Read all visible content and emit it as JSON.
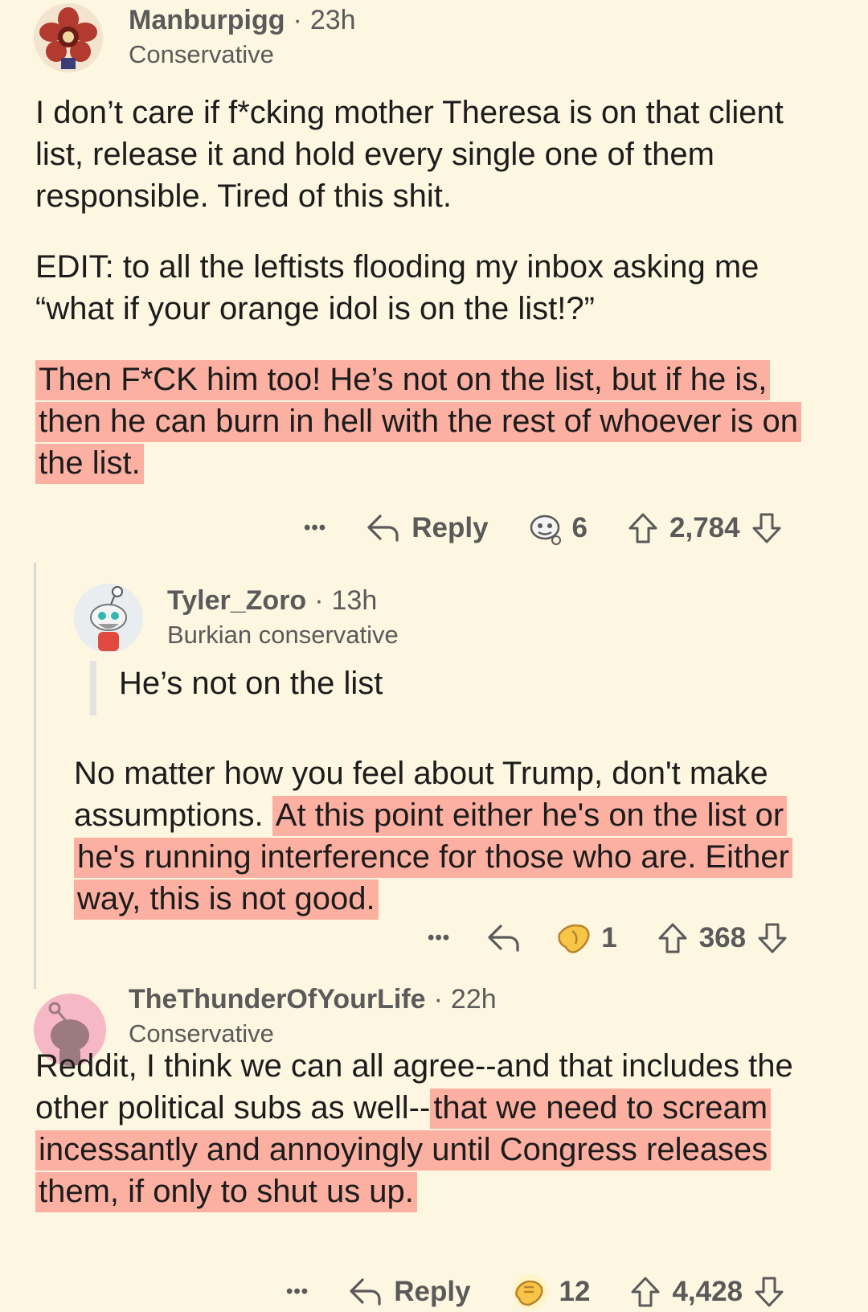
{
  "comments": [
    {
      "username": "Manburpigg",
      "time": "23h",
      "flair": "Conservative",
      "paragraphs": [
        "I don’t care if f*cking mother Theresa is on that client list, release it and hold every single one of them responsible. Tired of this shit.",
        "EDIT: to all the leftists flooding my inbox asking me “what if your orange idol is on the list!?”"
      ],
      "highlighted": "Then F*CK him too! He’s not on the list, but if he is, then he can burn in hell with the rest of whoever is on the list.",
      "actions": {
        "more": "•••",
        "reply": "Reply",
        "award_count": "6",
        "score": "2,784"
      }
    },
    {
      "username": "Tyler_Zoro",
      "time": "13h",
      "flair": "Burkian conservative",
      "quote": "He’s not on the list",
      "plain": "No matter how you feel about Trump, don't make assumptions. ",
      "highlighted": "At this point either he's on the list or he's running interference for those who are. Either way, this is not good.",
      "actions": {
        "more": "•••",
        "award_count": "1",
        "score": "368"
      }
    },
    {
      "username": "TheThunderOfYourLife",
      "time": "22h",
      "flair": "Conservative",
      "plain": "Reddit, I think we can all agree--and that includes the other political subs as well--",
      "highlighted": "that we need to scream incessantly and annoyingly until Congress releases them, if only to shut us up.",
      "actions": {
        "more": "•••",
        "reply": "Reply",
        "award_count": "12",
        "score": "4,428"
      }
    }
  ],
  "colors": {
    "background": "#fdf6e0",
    "highlight": "#fbb0a2",
    "meta": "#5a5a5a"
  },
  "icons": [
    "more-icon",
    "reply-icon",
    "award-icon",
    "upvote-icon",
    "downvote-icon"
  ]
}
